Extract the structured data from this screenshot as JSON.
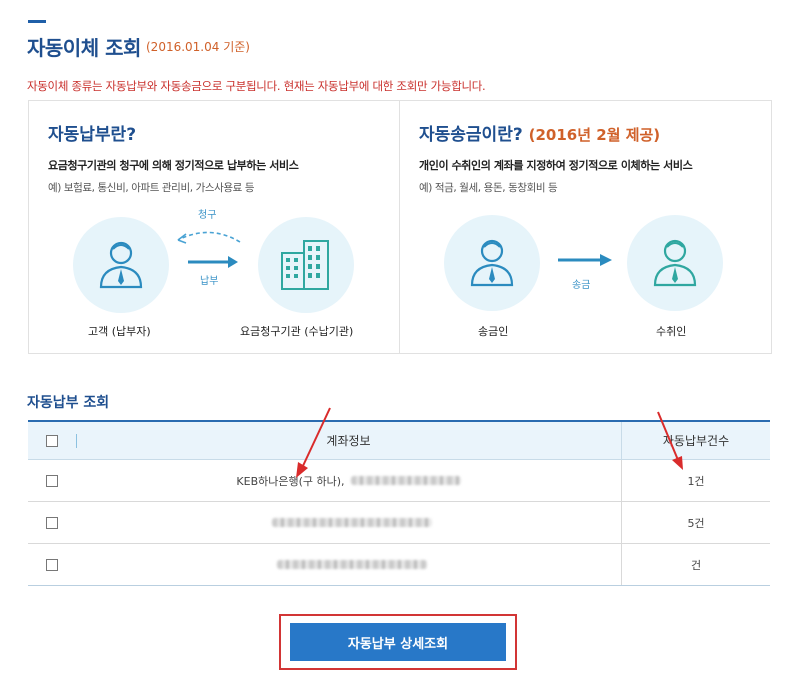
{
  "header": {
    "title": "자동이체 조회",
    "date": "(2016.01.04 기준)"
  },
  "notice": "자동이체 종류는 자동납부와 자동송금으로 구분됩니다. 현재는 자동납부에 대한 조회만 가능합니다.",
  "auto_payment": {
    "title": "자동납부란?",
    "desc": "요금청구기관의 청구에 의해 정기적으로 납부하는 서비스",
    "example": "예) 보험료, 통신비, 아파트 관리비, 가스사용료 등",
    "arrow_top": "청구",
    "arrow_bottom": "납부",
    "left_label": "고객 (납부자)",
    "right_label": "요금청구기관 (수납기관)"
  },
  "auto_transfer": {
    "title": "자동송금이란?",
    "title_sub": "(2016년 2월 제공)",
    "desc": "개인이 수취인의 계좌를 지정하여 정기적으로 이체하는 서비스",
    "example": "예) 적금, 월세, 용돈, 동창회비 등",
    "arrow_label": "송금",
    "left_label": "송금인",
    "right_label": "수취인"
  },
  "section": {
    "title": "자동납부 조회"
  },
  "table": {
    "headers": {
      "account": "계좌정보",
      "count": "자동납부건수"
    },
    "rows": [
      {
        "account": "KEB하나은행(구 하나),",
        "count": "1건"
      },
      {
        "account": "",
        "count": "5건"
      },
      {
        "account": "",
        "count": "건"
      }
    ]
  },
  "detail_button": "자동납부 상세조회",
  "colors": {
    "brand": "#1f4f8f",
    "accent_orange": "#d0612a",
    "notice_red": "#c9302c",
    "button_blue": "#2878c8",
    "highlight_red": "#d23535"
  }
}
